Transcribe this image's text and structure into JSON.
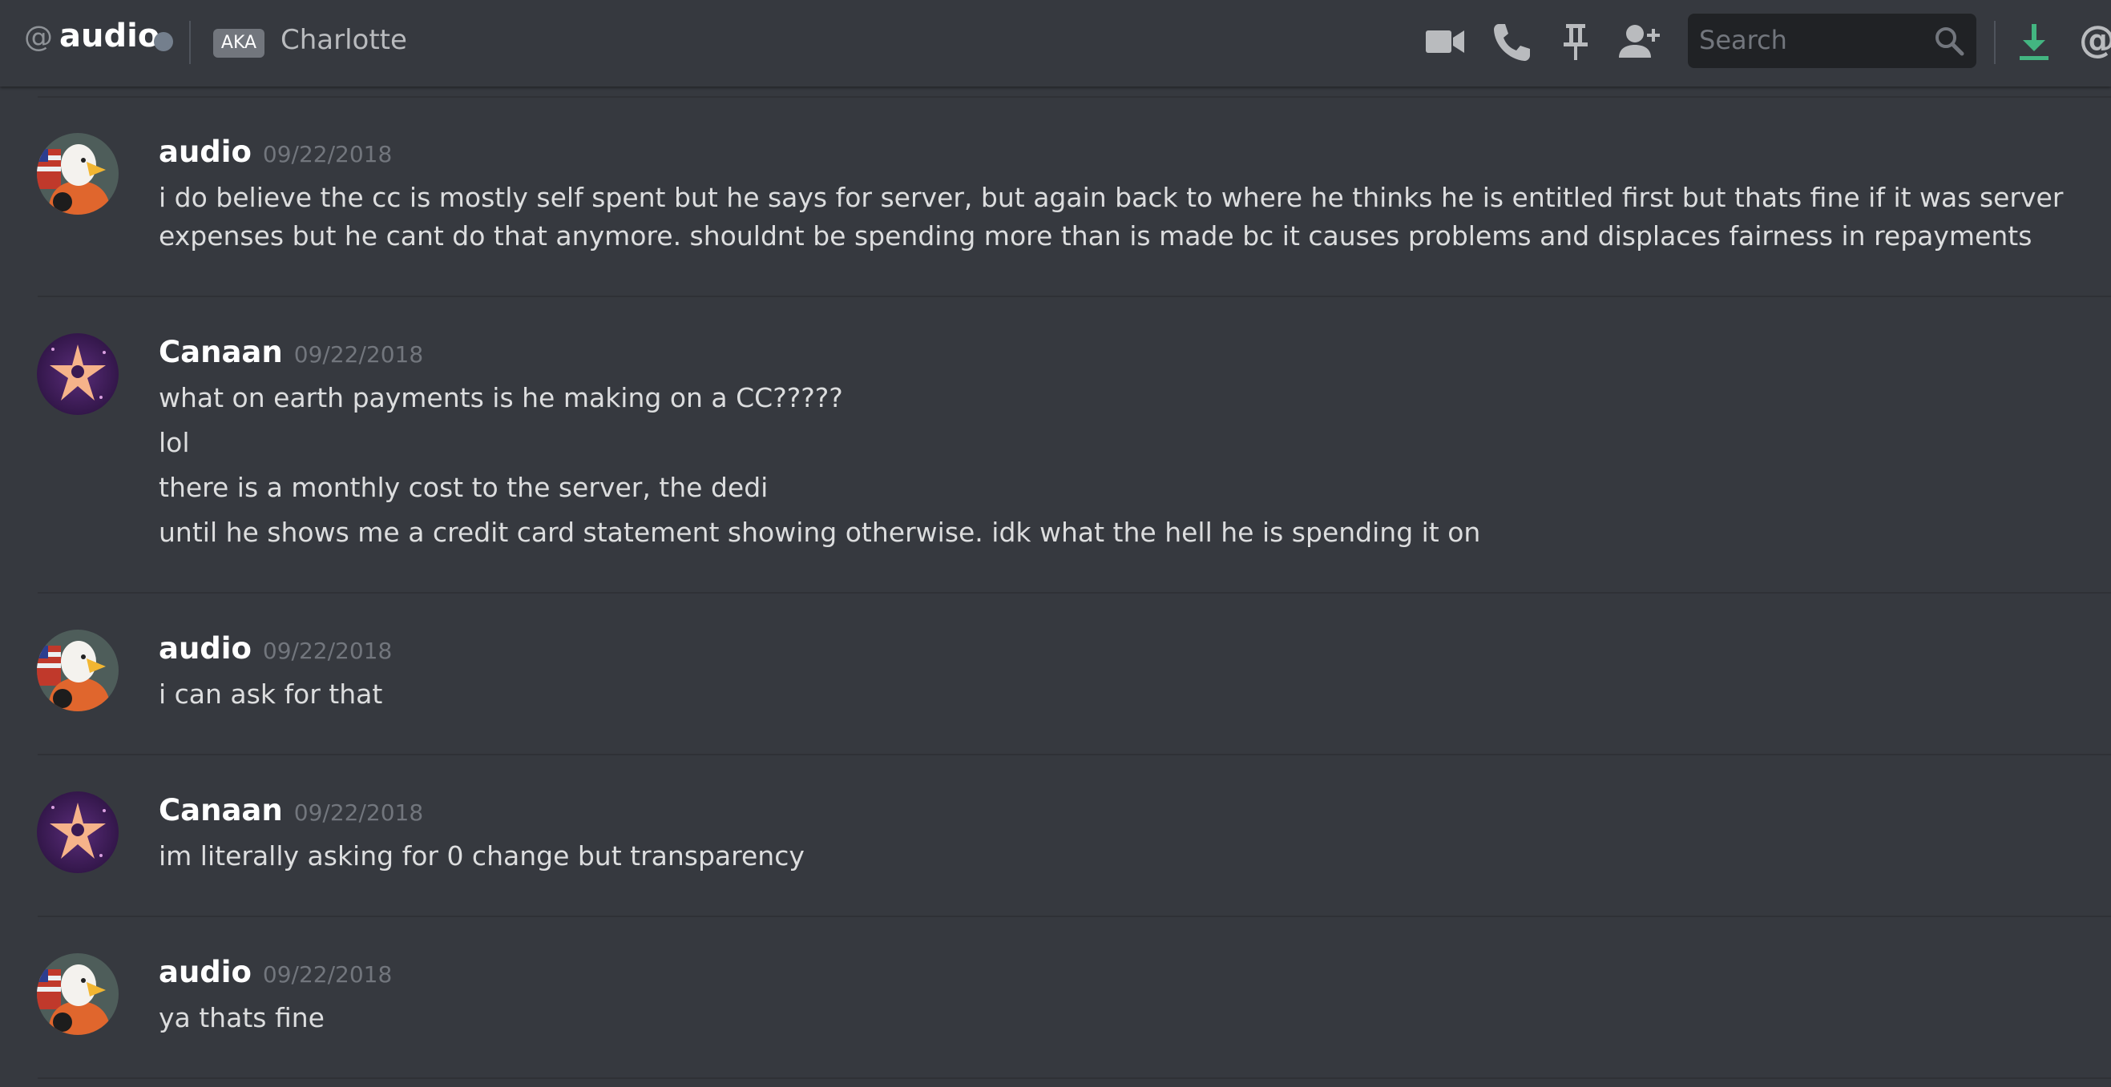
{
  "header": {
    "at_symbol": "@",
    "channel_name": "audio",
    "aka_badge": "AKA",
    "nickname": "Charlotte",
    "search_placeholder": "Search",
    "icons": [
      "video-call-icon",
      "voice-call-icon",
      "pin-icon",
      "add-friend-icon",
      "search-icon",
      "download-icon",
      "mention-icon"
    ],
    "download_color": "#43b581",
    "cutoff_at": "@"
  },
  "colors": {
    "background": "#36393f",
    "divider": "#2f3136",
    "username": "#ffffff",
    "timestamp": "#72767d",
    "message": "#dcddde"
  },
  "messages": [
    {
      "author": "audio",
      "avatar": "eagle-astronaut-avatar",
      "timestamp": "09/22/2018",
      "lines": [
        "i do believe the cc is mostly self spent but he says for server, but again back to where he thinks he is entitled first but thats fine if it was server expenses but he cant do that anymore. shouldnt be spending more than is made bc it causes problems and displaces fairness in repayments"
      ]
    },
    {
      "author": "Canaan",
      "avatar": "star-emblem-avatar",
      "timestamp": "09/22/2018",
      "lines": [
        "what on earth payments is he making on a CC?????",
        "lol",
        "there is a monthly cost to the server, the dedi",
        "until he shows me a credit card statement showing otherwise. idk what the hell he is spending it on"
      ]
    },
    {
      "author": "audio",
      "avatar": "eagle-astronaut-avatar",
      "timestamp": "09/22/2018",
      "lines": [
        "i can ask for that"
      ]
    },
    {
      "author": "Canaan",
      "avatar": "star-emblem-avatar",
      "timestamp": "09/22/2018",
      "lines": [
        "im literally asking for 0 change but transparency"
      ]
    },
    {
      "author": "audio",
      "avatar": "eagle-astronaut-avatar",
      "timestamp": "09/22/2018",
      "lines": [
        "ya thats fine"
      ]
    }
  ]
}
